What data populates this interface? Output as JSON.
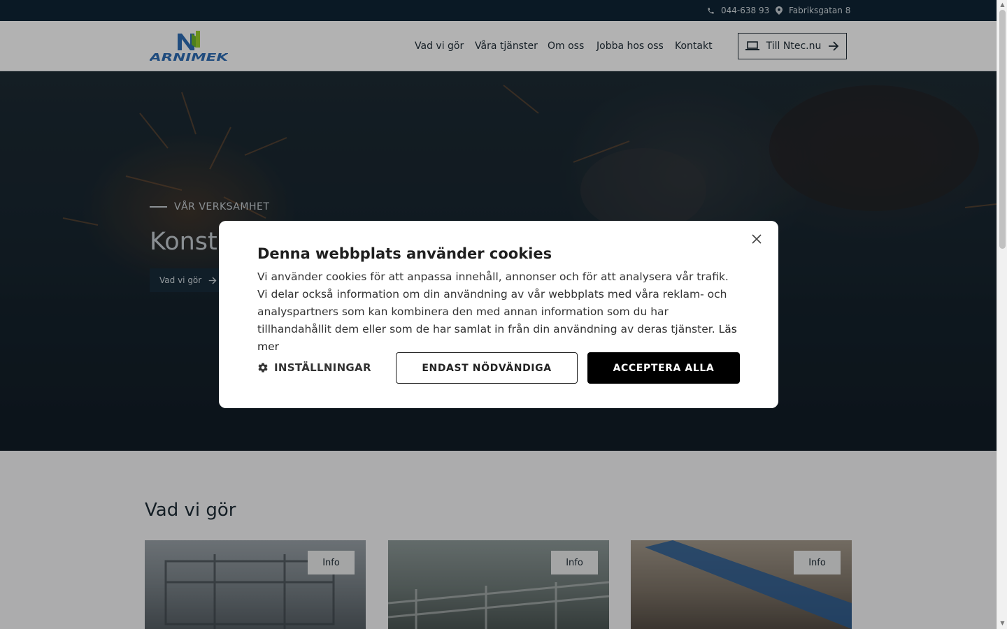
{
  "topbar": {
    "phone": "044-638 93",
    "address": "Fabriksgatan 8"
  },
  "header": {
    "logo_text": "ARNIMEK",
    "nav": [
      "Vad vi gör",
      "Våra tjänster",
      "Om oss",
      "Jobba hos oss",
      "Kontakt"
    ],
    "cta_label": "Till Ntec.nu"
  },
  "hero": {
    "eyebrow": "VÅR VERKSAMHET",
    "title": "Konstr",
    "button_label": "Vad vi gör"
  },
  "section": {
    "title": "Vad vi gör",
    "cards": [
      {
        "info_label": "Info"
      },
      {
        "info_label": "Info"
      },
      {
        "info_label": "Info"
      }
    ]
  },
  "cookie_dialog": {
    "title": "Denna webbplats använder cookies",
    "body": "Vi använder cookies för att anpassa innehåll, annonser och för att analysera vår trafik. Vi delar också information om din användning av vår webbplats med våra reklam- och analyspartners som kan kombinera den med annan information som du har tillhandahållit dem eller som de har samlat in från din användning av deras tjänster.",
    "read_more": "Läs mer",
    "settings_label": "INSTÄLLNINGAR",
    "necessary_label": "ENDAST NÖDVÄNDIGA",
    "accept_label": "ACCEPTERA ALLA"
  },
  "colors": {
    "topbar": "#0f2535",
    "accent_logo_blue": "#2f6db5",
    "accent_logo_green": "#9bd02c",
    "accept_bg": "#000000"
  }
}
